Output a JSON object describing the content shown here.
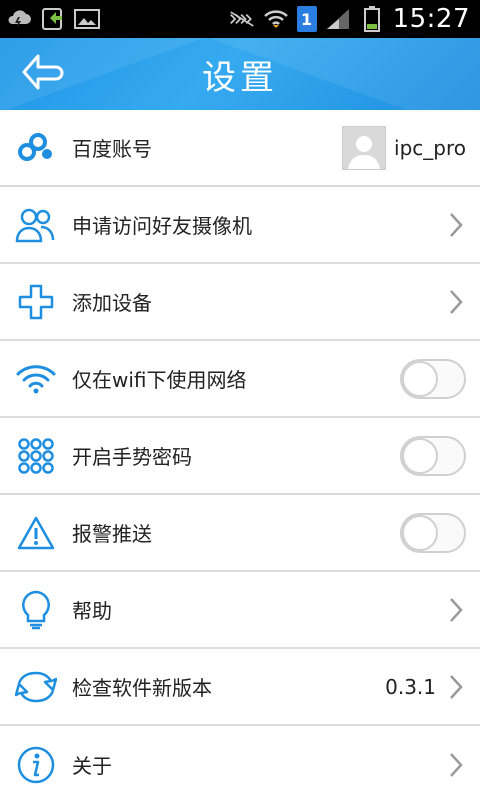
{
  "status_bar": {
    "time": "15:27",
    "sim_badge": "1",
    "left_icons": [
      "weather-icon",
      "download-icon",
      "image-icon"
    ],
    "right_icons": [
      "mute-icon",
      "wifi-icon",
      "signal-icon",
      "battery-icon"
    ]
  },
  "header": {
    "title": "设置",
    "back_icon": "back-arrow-icon",
    "bg_color": "#2ea3ee"
  },
  "rows": [
    {
      "label": "百度账号",
      "icon": "baidu-cloud-icon",
      "value": "ipc_pro",
      "control": "avatar"
    },
    {
      "label": "申请访问好友摄像机",
      "icon": "friends-icon",
      "control": "chevron"
    },
    {
      "label": "添加设备",
      "icon": "plus-icon",
      "control": "chevron"
    },
    {
      "label": "仅在wifi下使用网络",
      "icon": "wifi-icon",
      "control": "toggle",
      "on": false
    },
    {
      "label": "开启手势密码",
      "icon": "grid-dots-icon",
      "control": "toggle",
      "on": false
    },
    {
      "label": "报警推送",
      "icon": "warning-icon",
      "control": "toggle",
      "on": false
    },
    {
      "label": "帮助",
      "icon": "lightbulb-icon",
      "control": "chevron"
    },
    {
      "label": "检查软件新版本",
      "icon": "update-icon",
      "value": "0.3.1",
      "control": "chevron"
    },
    {
      "label": "关于",
      "icon": "info-icon",
      "control": "chevron"
    }
  ],
  "colors": {
    "accent": "#1e8fe0",
    "divider": "#dcdcdc",
    "toggle_off": "#d0d0d0"
  }
}
